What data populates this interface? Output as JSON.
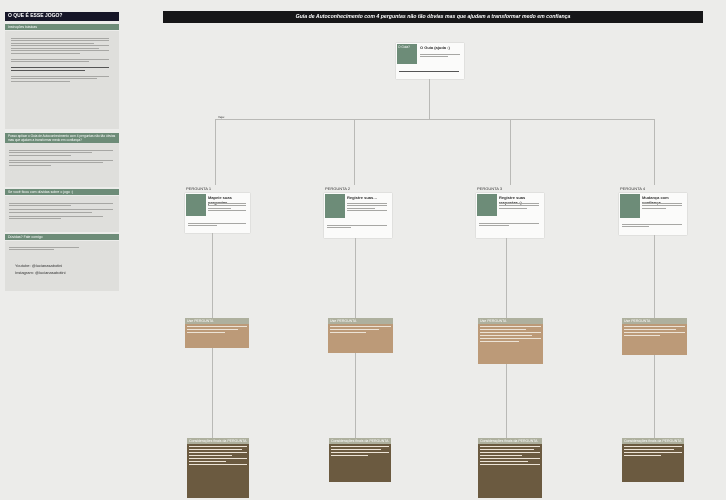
{
  "sidebar": {
    "title": "O QUE É ESSE JOGO?",
    "section1": "Instruções básicas",
    "section2": "Posso aplicar o Guia de Autoconhecimento com 4 perguntas não tão óbvias mas que ajudam a transformar medo em confiança?",
    "section3": "Se você ficou com dúvidas sobre o jogo :)",
    "section4": "Dúvidas? Fale comigo",
    "contact_1": "Youtube: @lucianasabotini",
    "contact_2": "Instagram: @lucianasabotini"
  },
  "header": {
    "title": "Guia de Autoconhecimento com 4 perguntas não tão óbvias mas que ajudam a transformar medo em confiança"
  },
  "root": {
    "label": "O Guia?",
    "card_title": "O Guia (ajuda :)",
    "connector_label": "Veja:"
  },
  "questions": [
    {
      "label": "PERGUNTA 1",
      "card_title": "Mapeie suas perguntas",
      "mid_title": "Use PERGUNTA",
      "bot_title": "Considerações finais da PERGUNTA"
    },
    {
      "label": "PERGUNTA 2",
      "card_title": "Registre suas…",
      "mid_title": "Use PERGUNTA",
      "bot_title": "Considerações finais da PERGUNTA"
    },
    {
      "label": "PERGUNTA 3",
      "card_title": "Registre suas respostas :)",
      "mid_title": "Use PERGUNTA",
      "bot_title": "Considerações finais da PERGUNTA"
    },
    {
      "label": "PERGUNTA 4",
      "card_title": "Mudança com confiança",
      "mid_title": "Use PERGUNTA",
      "bot_title": "Considerações finais da PERGUNTA"
    }
  ],
  "colors": {
    "green": "#6d8c78",
    "tan": "#bc9a78",
    "brown": "#6b5a40",
    "header": "#161618"
  }
}
